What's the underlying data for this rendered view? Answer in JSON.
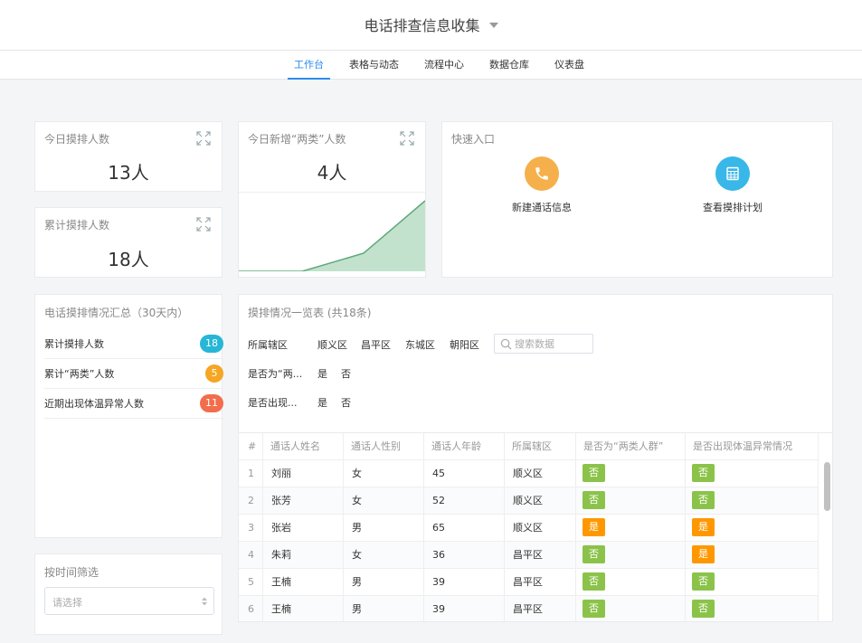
{
  "app": {
    "title": "电话排查信息收集"
  },
  "nav": {
    "tabs": [
      "工作台",
      "表格与动态",
      "流程中心",
      "数据仓库",
      "仪表盘"
    ]
  },
  "cards": {
    "today": {
      "title": "今日摸排人数",
      "value": "13人"
    },
    "total": {
      "title": "累计摸排人数",
      "value": "18人"
    },
    "new_two": {
      "title": "今日新增“两类”人数",
      "value": "4人"
    }
  },
  "quick": {
    "title": "快速入口",
    "items": [
      {
        "label": "新建通话信息",
        "icon": "phone-icon",
        "color": "#f5b04c"
      },
      {
        "label": "查看摸排计划",
        "icon": "table-icon",
        "color": "#38b7e8"
      }
    ]
  },
  "summary": {
    "title": "电话摸排情况汇总（30天内）",
    "rows": [
      {
        "label": "累计摸排人数",
        "count": "18",
        "color": "#26b6d6"
      },
      {
        "label": "累计“两类”人数",
        "count": "5",
        "color": "#f5a623"
      },
      {
        "label": "近期出现体温异常人数",
        "count": "11",
        "color": "#f26d4b"
      }
    ]
  },
  "list": {
    "title": "摸排情况一览表 (共18条)",
    "filters": {
      "district_label": "所属辖区",
      "districts": [
        "顺义区",
        "昌平区",
        "东城区",
        "朝阳区"
      ],
      "search_placeholder": "搜索数据",
      "two_label": "是否为“两...",
      "temp_label": "是否出现...",
      "yes": "是",
      "no": "否"
    },
    "columns": [
      "#",
      "通话人姓名",
      "通话人性别",
      "通话人年龄",
      "所属辖区",
      "是否为“两类人群”",
      "是否出现体温异常情况"
    ],
    "rows": [
      {
        "n": "1",
        "name": "刘丽",
        "gender": "女",
        "age": "45",
        "district": "顺义区",
        "two": "否",
        "temp": "否"
      },
      {
        "n": "2",
        "name": "张芳",
        "gender": "女",
        "age": "52",
        "district": "顺义区",
        "two": "否",
        "temp": "否"
      },
      {
        "n": "3",
        "name": "张岩",
        "gender": "男",
        "age": "65",
        "district": "顺义区",
        "two": "是",
        "temp": "是"
      },
      {
        "n": "4",
        "name": "朱莉",
        "gender": "女",
        "age": "36",
        "district": "昌平区",
        "two": "否",
        "temp": "是"
      },
      {
        "n": "5",
        "name": "王楠",
        "gender": "男",
        "age": "39",
        "district": "昌平区",
        "two": "否",
        "temp": "否"
      },
      {
        "n": "6",
        "name": "王楠",
        "gender": "男",
        "age": "39",
        "district": "昌平区",
        "two": "否",
        "temp": "否"
      }
    ]
  },
  "time_filter": {
    "title": "按时间筛选",
    "placeholder": "请选择"
  }
}
